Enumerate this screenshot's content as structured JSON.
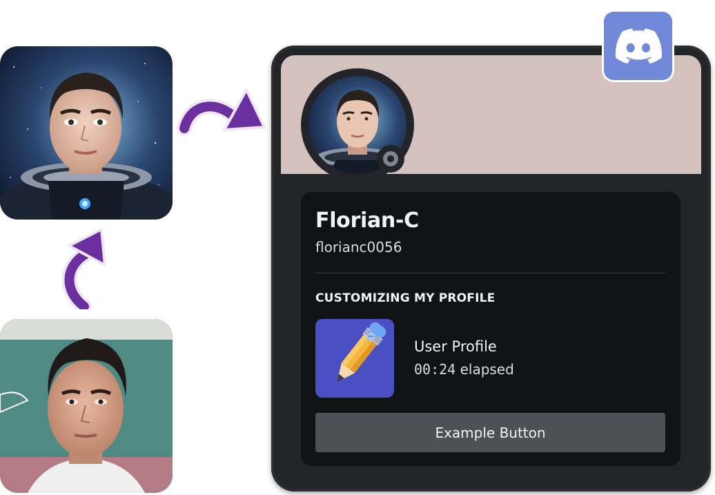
{
  "profile": {
    "display_name": "Florian-C",
    "username": "florianc0056",
    "status": "offline"
  },
  "activity": {
    "section_title": "CUSTOMIZING MY PROFILE",
    "name": "User Profile",
    "elapsed_time": "00:24",
    "elapsed_suffix": " elapsed",
    "icon": "pencil-icon"
  },
  "button": {
    "label": "Example Button"
  },
  "colors": {
    "banner": "#d3c1bd",
    "card_background": "#232428",
    "inner_background": "#111214",
    "button_background": "#4e5058",
    "discord_brand": "#7289da",
    "arrow": "#6b2fa0",
    "status_offline": "#80848e"
  },
  "icons": {
    "discord_logo": "discord-logo-icon",
    "arrow_up": "curved-arrow-up-icon",
    "arrow_right": "curved-arrow-right-icon"
  }
}
